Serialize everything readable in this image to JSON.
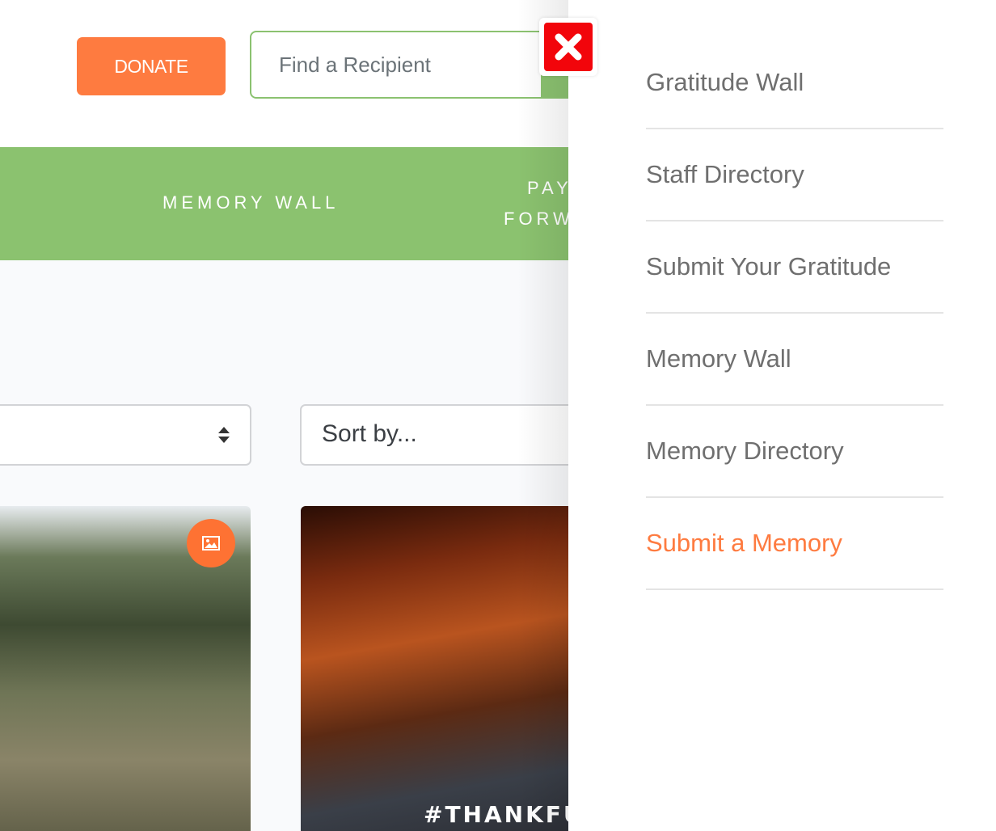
{
  "header": {
    "donate_label": "DONATE",
    "search_placeholder": "Find a Recipient"
  },
  "nav": {
    "items": [
      {
        "label": "MEMORY WALL"
      },
      {
        "label_line1": "PAY",
        "label_line2": "FORW"
      }
    ]
  },
  "filters": {
    "sort_placeholder": "Sort by..."
  },
  "cards": [
    {
      "badge_icon": "image-icon"
    },
    {
      "overlay_text": "#THANKFU"
    }
  ],
  "side_menu": {
    "items": [
      {
        "label": "Gratitude Wall"
      },
      {
        "label": "Staff Directory"
      },
      {
        "label": "Submit Your Gratitude"
      },
      {
        "label": "Memory Wall"
      },
      {
        "label": "Memory Directory"
      },
      {
        "label": "Submit a Memory",
        "active": true
      }
    ]
  },
  "colors": {
    "accent": "#fe7b40",
    "nav_green": "#8bc26f",
    "close_red": "#f2050b",
    "menu_text": "#6f6f6f"
  }
}
